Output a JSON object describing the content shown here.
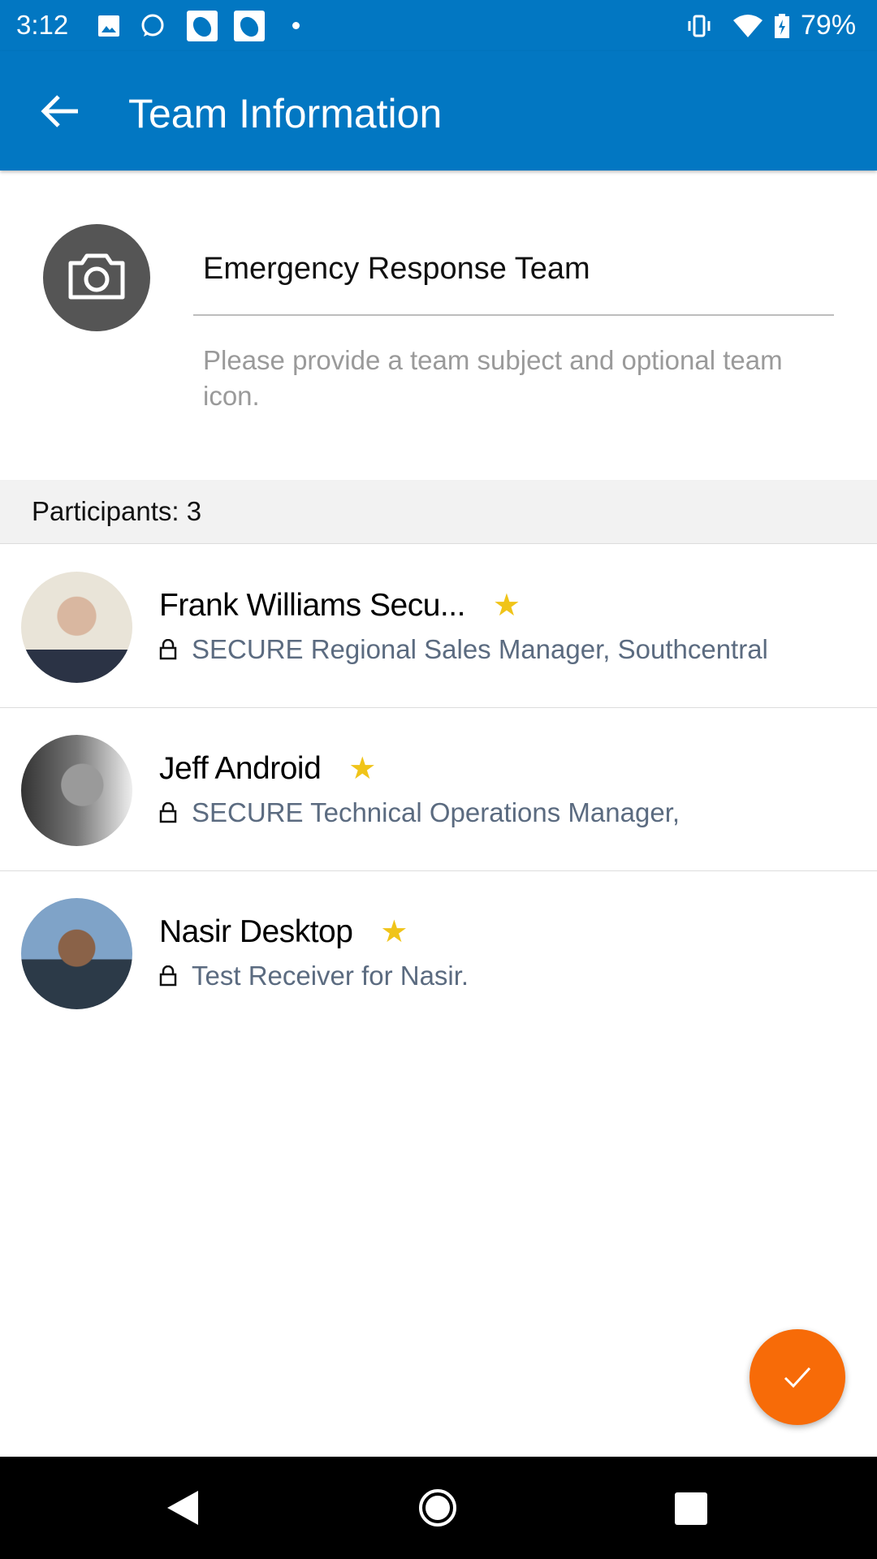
{
  "status_bar": {
    "time": "3:12",
    "battery": "79%",
    "icons": [
      "image-icon",
      "whatsapp-icon",
      "app-icon",
      "app-icon",
      "dot-icon",
      "vibrate-icon",
      "wifi-icon",
      "battery-charging-icon"
    ]
  },
  "app_bar": {
    "title": "Team Information",
    "back_icon": "arrow-left-icon"
  },
  "team": {
    "subject": "Emergency Response Team",
    "helper": "Please provide a team subject and optional team icon.",
    "icon": "camera-icon"
  },
  "participants": {
    "header": "Participants: 3",
    "items": [
      {
        "name": "Frank Williams Secu...",
        "subtitle": "SECURE Regional Sales Manager, Southcentral",
        "starred": true
      },
      {
        "name": "Jeff Android",
        "subtitle": "SECURE Technical Operations Manager,",
        "starred": true
      },
      {
        "name": "Nasir Desktop",
        "subtitle": "Test Receiver for Nasir.",
        "starred": true
      }
    ]
  },
  "fab": {
    "icon": "check-icon",
    "color": "#f76b08"
  },
  "colors": {
    "primary": "#0277c2",
    "star": "#f0c419",
    "subtitle": "#5b6b80"
  },
  "star_glyph": "★"
}
